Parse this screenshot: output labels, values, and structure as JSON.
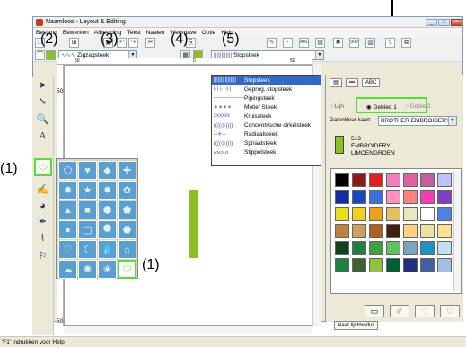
{
  "window": {
    "title": "Naamloos - Layout & Editing"
  },
  "menu": [
    "Bestand",
    "Bewerken",
    "Afbeelding",
    "Tekst",
    "Naaien",
    "Weergave",
    "Optie",
    "Help"
  ],
  "callouts": {
    "c1a": "(1)",
    "c1b": "(1)",
    "c2": "(2)",
    "c3": "(3)",
    "c4": "(4)",
    "c5": "(5)"
  },
  "toolbar2": {
    "line_style": "Zigzagsteek",
    "fill_style": "Stopsteek"
  },
  "dropdown_items": [
    {
      "icon": "||||||||||||||||",
      "label": "Stopsteek"
    },
    {
      "icon": "|·|·|·|·|·|",
      "label": "Geprog. stopsteek"
    },
    {
      "icon": "────────",
      "label": "Pipingsteek"
    },
    {
      "icon": "✶✶✶✶",
      "label": "Motief Steek"
    },
    {
      "icon": "xxxxxx",
      "label": "Kruissteek"
    },
    {
      "icon": "((((◎))))",
      "label": "Concentrische cirkelsteek"
    },
    {
      "icon": "─✳─",
      "label": "Radiaalsteek"
    },
    {
      "icon": "((((◎))))",
      "label": "Spiraalsteek"
    },
    {
      "icon": "ᔕᔕᔕ",
      "label": "Stippelsteek"
    }
  ],
  "right_panel": {
    "tab_abc": "ABC",
    "radio_lijn": "Lijn",
    "radio_gebied1": "Gebied 1",
    "radio_gebied2": "Gebie",
    "radio_gebied2b": "2",
    "thread_brand_label": "Garenkleur-kaart",
    "thread_brand_value": "BROTHER EMBROIDERY",
    "thread_num": "513",
    "thread_line1": "EMBROIDERY",
    "thread_line2": "LIMOENGROEN",
    "new_list_button": "Naar lijstmodus"
  },
  "ruler": {
    "r50": "50",
    "r0": "0",
    "r50b": "50",
    "vr50": "50",
    "vr50b": "50"
  },
  "status_text": "'F1' indrukken voor Help",
  "colors": {
    "accent": "#55dd33",
    "stitch_green": "#8cbf26",
    "window_border": "#7f9db9"
  },
  "swatches": [
    "#000000",
    "#8b1a1a",
    "#e02020",
    "#f080c0",
    "#e060a0",
    "#c060a0",
    "#c0c0ff",
    "#1030a0",
    "#1848c0",
    "#4070e0",
    "#ff90c0",
    "#ff8080",
    "#f040b0",
    "#8040c0",
    "#e8e020",
    "#f0d020",
    "#f0a020",
    "#e0c060",
    "#e8e8c0",
    "#ffffff",
    "#5080e0",
    "#c08040",
    "#d0a060",
    "#b06020",
    "#402010",
    "#ffd080",
    "#f0e0a0",
    "#ffe090",
    "#104020",
    "#208040",
    "#40a040",
    "#60c060",
    "#80a0c0",
    "#2090c0",
    "#c0e0f0",
    "#208040",
    "#406030",
    "#90c040",
    "#006030",
    "#203080",
    "#4060a0",
    "#a0c0e0"
  ]
}
